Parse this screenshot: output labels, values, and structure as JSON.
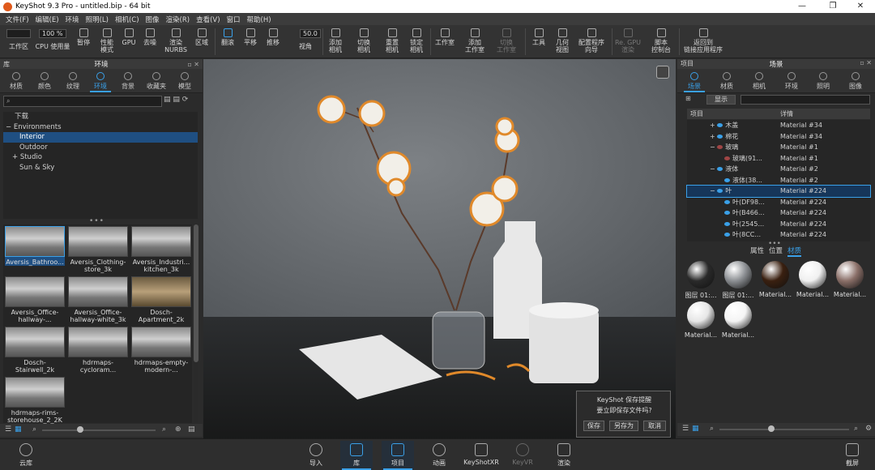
{
  "app": {
    "title": "KeyShot 9.3 Pro  - untitled.bip  - 64 bit"
  },
  "window_controls": [
    "—",
    "❐",
    "✕"
  ],
  "menu": [
    "文件(F)",
    "编辑(E)",
    "环境",
    "照明(L)",
    "相机(C)",
    "图像",
    "渲染(R)",
    "查看(V)",
    "窗口",
    "帮助(H)"
  ],
  "toolbar": {
    "input_value": "100 %",
    "number_value": "50.0",
    "items": [
      {
        "id": "workspace",
        "label": "工作区"
      },
      {
        "id": "cpu",
        "label": "CPU 使用量"
      },
      {
        "id": "pause",
        "label": "暂停"
      },
      {
        "id": "perf",
        "label": "性能\n模式"
      },
      {
        "id": "gpu",
        "label": "GPU"
      },
      {
        "id": "denoise",
        "label": "去噪"
      },
      {
        "id": "nurbs",
        "label": "渲染\nNURBS"
      },
      {
        "id": "region",
        "label": "区域"
      },
      {
        "id": "tumble",
        "label": "翻滚"
      },
      {
        "id": "pan",
        "label": "平移"
      },
      {
        "id": "dolly",
        "label": "推移"
      },
      {
        "id": "fov",
        "label": "视角"
      },
      {
        "id": "addcam",
        "label": "添加\n相机"
      },
      {
        "id": "switchcam",
        "label": "切换\n相机"
      },
      {
        "id": "resetcam",
        "label": "重置\n相机"
      },
      {
        "id": "lockcam",
        "label": "锁定\n相机"
      },
      {
        "id": "studio",
        "label": "工作室"
      },
      {
        "id": "addstudio",
        "label": "添加\n工作室"
      },
      {
        "id": "switchstudio",
        "label": "切换\n工作室"
      },
      {
        "id": "tools",
        "label": "工具"
      },
      {
        "id": "geomview",
        "label": "几何\n视图"
      },
      {
        "id": "wizard",
        "label": "配置程序\n向导"
      },
      {
        "id": "vr",
        "label": "Re. GPU\n渲染"
      },
      {
        "id": "script",
        "label": "脚本\n控制台"
      },
      {
        "id": "back",
        "label": "返回到\n链接应用程序"
      }
    ]
  },
  "library": {
    "panel_label": "库",
    "title": "环境",
    "tabs": [
      "材质",
      "颜色",
      "纹理",
      "环境",
      "背景",
      "收藏夹",
      "模型"
    ],
    "active_tab": 3,
    "search_placeholder": "",
    "tree": [
      {
        "label": "下载",
        "indent": 0,
        "prefix": ""
      },
      {
        "label": "Environments",
        "indent": 0,
        "prefix": "−"
      },
      {
        "label": "Interior",
        "indent": 1,
        "prefix": "",
        "selected": true
      },
      {
        "label": "Outdoor",
        "indent": 1,
        "prefix": ""
      },
      {
        "label": "Studio",
        "indent": 1,
        "prefix": "+"
      },
      {
        "label": "Sun & Sky",
        "indent": 1,
        "prefix": ""
      }
    ],
    "thumbnails": [
      {
        "label": "Aversis_Bathroo...",
        "selected": true
      },
      {
        "label": "Aversis_Clothing-\nstore_3k"
      },
      {
        "label": "Aversis_Industri...\nkitchen_3k"
      },
      {
        "label": "Aversis_Office-\nhallway-..."
      },
      {
        "label": "Aversis_Office-\nhallway-white_3k"
      },
      {
        "label": "Dosch-\nApartment_2k"
      },
      {
        "label": "Dosch-\nStairwell_2k"
      },
      {
        "label": "hdrmaps-\ncycloram..."
      },
      {
        "label": "hdrmaps-empty-\nmodern-..."
      },
      {
        "label": "hdrmaps-rims-\nstorehouse_2_2K"
      }
    ]
  },
  "dialog": {
    "title": "KeyShot 保存提醒",
    "message": "要立即保存文件吗?",
    "buttons": [
      "保存",
      "另存为",
      "取消"
    ]
  },
  "project": {
    "panel_label": "项目",
    "title": "场景",
    "tabs": [
      "场景",
      "材质",
      "相机",
      "环境",
      "照明",
      "图像"
    ],
    "active_tab": 0,
    "show_label": "显示",
    "columns": [
      "项目",
      "详情"
    ],
    "rows": [
      {
        "name": "木盖",
        "detail": "Material #34",
        "indent": 2
      },
      {
        "name": "棉花",
        "detail": "Material #34",
        "indent": 2
      },
      {
        "name": "玻璃",
        "detail": "Material #1",
        "indent": 2
      },
      {
        "name": "玻璃(91...",
        "detail": "Material #1",
        "indent": 3
      },
      {
        "name": "液体",
        "detail": "Material #2",
        "indent": 2
      },
      {
        "name": "液体(38...",
        "detail": "Material #2",
        "indent": 3
      },
      {
        "name": "叶",
        "detail": "Material #224",
        "indent": 2,
        "selected": true
      },
      {
        "name": "叶(DF98...",
        "detail": "Material #224",
        "indent": 3
      },
      {
        "name": "叶(B466...",
        "detail": "Material #224",
        "indent": 3
      },
      {
        "name": "叶(2545...",
        "detail": "Material #224",
        "indent": 3
      },
      {
        "name": "叶(8CC...",
        "detail": "Material #224",
        "indent": 3
      }
    ],
    "subtabs": [
      "属性",
      "位置",
      "材质"
    ],
    "active_subtab": 2,
    "materials": [
      {
        "label": "图层 01:...",
        "color": "#2a2a2a"
      },
      {
        "label": "图层 01:...",
        "color": "#8c8f93"
      },
      {
        "label": "Material...",
        "color": "#3a2010"
      },
      {
        "label": "Material...",
        "color": "#f0f0f0"
      },
      {
        "label": "Material...",
        "color": "#8a6f68"
      },
      {
        "label": "Material...",
        "color": "#e6e6e6"
      },
      {
        "label": "Material...",
        "color": "#f4f4f4"
      }
    ]
  },
  "ribbon": {
    "left": [
      {
        "label": "云库"
      }
    ],
    "center": [
      {
        "label": "导入"
      },
      {
        "label": "库",
        "active": true
      },
      {
        "label": "项目",
        "active": true
      },
      {
        "label": "动画"
      },
      {
        "label": "KeyShotXR"
      },
      {
        "label": "KeyVR",
        "dim": true
      },
      {
        "label": "渲染"
      }
    ],
    "right": [
      {
        "label": "截屏"
      }
    ]
  }
}
